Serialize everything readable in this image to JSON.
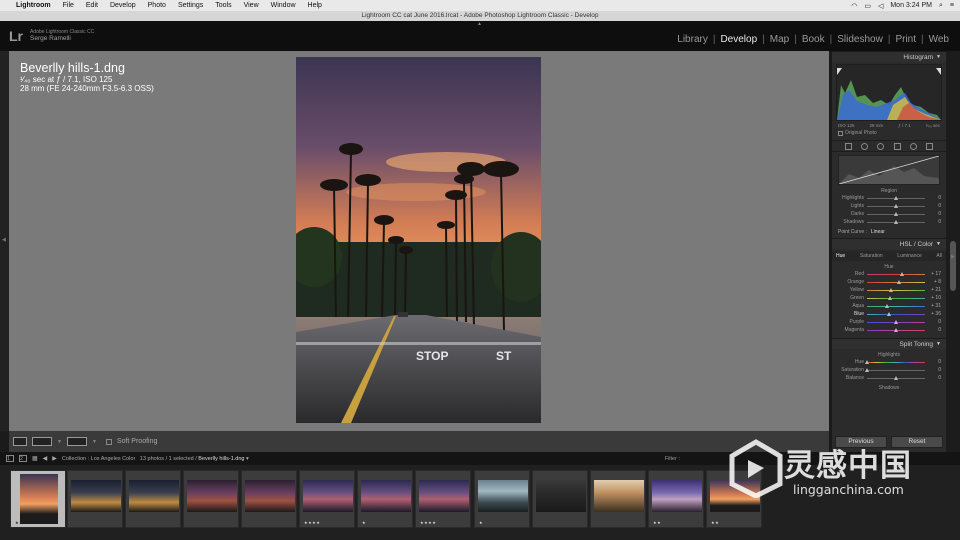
{
  "menubar": {
    "app": "Lightroom",
    "items": [
      "File",
      "Edit",
      "Develop",
      "Photo",
      "Settings",
      "Tools",
      "View",
      "Window",
      "Help"
    ],
    "clock": "Mon 3:24 PM"
  },
  "window": {
    "title": "Lightroom CC cat June 2016.lrcat - Adobe Photoshop Lightroom Classic - Develop"
  },
  "identity": {
    "logo": "Lr",
    "product": "Adobe Lightroom Classic CC",
    "user": "Serge Ramelli"
  },
  "modules": [
    "Library",
    "Develop",
    "Map",
    "Book",
    "Slideshow",
    "Print",
    "Web"
  ],
  "active_module": "Develop",
  "info": {
    "filename": "Beverlly hills-1.dng",
    "exposure": "¹⁄₄₀ sec at ƒ / 7.1, ISO 125",
    "lens": "28 mm (FE 24-240mm F3.5-6.3 OSS)"
  },
  "toolbar": {
    "soft_proofing": "Soft Proofing"
  },
  "right_panel": {
    "histogram": {
      "title": "Histogram",
      "iso": "ISO 125",
      "focal": "28 mm",
      "aperture": "ƒ / 7.1",
      "shutter": "¹⁄₄₀ sec",
      "original_photo": "Original Photo"
    },
    "tone_curve": {
      "region_label": "Region",
      "sliders": [
        {
          "label": "Highlights",
          "value": "0",
          "pos": 0.5
        },
        {
          "label": "Lights",
          "value": "0",
          "pos": 0.5
        },
        {
          "label": "Darks",
          "value": "0",
          "pos": 0.5
        },
        {
          "label": "Shadows",
          "value": "0",
          "pos": 0.5
        }
      ],
      "point_curve_label": "Point Curve :",
      "point_curve_value": "Linear"
    },
    "hsl": {
      "title": "HSL / Color",
      "tabs": [
        "Hue",
        "Saturation",
        "Luminance",
        "All"
      ],
      "active_tab": "Hue",
      "section": "Hue",
      "sliders": [
        {
          "label": "Red",
          "value": "+ 17",
          "pos": 0.62
        },
        {
          "label": "Orange",
          "value": "+ 8",
          "pos": 0.56
        },
        {
          "label": "Yellow",
          "value": "+ 21",
          "pos": 0.42
        },
        {
          "label": "Green",
          "value": "+ 10",
          "pos": 0.4
        },
        {
          "label": "Aqua",
          "value": "+ 31",
          "pos": 0.35
        },
        {
          "label": "Blue",
          "value": "+ 36",
          "pos": 0.38
        },
        {
          "label": "Purple",
          "value": "0",
          "pos": 0.5
        },
        {
          "label": "Magenta",
          "value": "0",
          "pos": 0.5
        }
      ],
      "active_slider": "Blue"
    },
    "split_toning": {
      "title": "Split Toning",
      "highlights_label": "Highlights",
      "hue_label": "Hue",
      "saturation_label": "Saturation",
      "hue_value": "0",
      "saturation_value": "0",
      "balance_label": "Balance",
      "balance_value": "0",
      "shadows_label": "Shadows"
    },
    "buttons": {
      "previous": "Previous",
      "reset": "Reset"
    }
  },
  "filmstrip_bar": {
    "pages": [
      "1",
      "2"
    ],
    "collection": "Collection : Los Angeles Color",
    "count": "13 photos / 1 selected /",
    "file": "Beverlly hills-1.dng",
    "filter": "Filter :"
  },
  "filmstrip": {
    "thumbs": [
      {
        "stars": "★★",
        "theme": "sunset-palms",
        "selected": true
      },
      {
        "stars": "",
        "theme": "city-night"
      },
      {
        "stars": "",
        "theme": "city-night"
      },
      {
        "stars": "",
        "theme": "dusk"
      },
      {
        "stars": "",
        "theme": "dusk"
      },
      {
        "stars": "★★★★",
        "theme": "purple-skyline"
      },
      {
        "stars": "★",
        "theme": "purple-skyline"
      },
      {
        "stars": "★★★★",
        "theme": "purple-skyline"
      },
      {
        "stars": "★",
        "theme": "teal-street"
      },
      {
        "stars": "",
        "theme": "dark-trees"
      },
      {
        "stars": "",
        "theme": "warm-trees"
      },
      {
        "stars": "★★",
        "theme": "purple-building"
      },
      {
        "stars": "★★",
        "theme": "sunset-palms"
      }
    ]
  },
  "watermark": {
    "brand": "灵感中国",
    "url": "lingganchina.com"
  },
  "colors": {
    "accent_active": "#e8e8e8",
    "panel_bg": "#2b2b2b",
    "main_bg": "#7a7a7a",
    "selected_thumb": "#bcbcbc"
  }
}
